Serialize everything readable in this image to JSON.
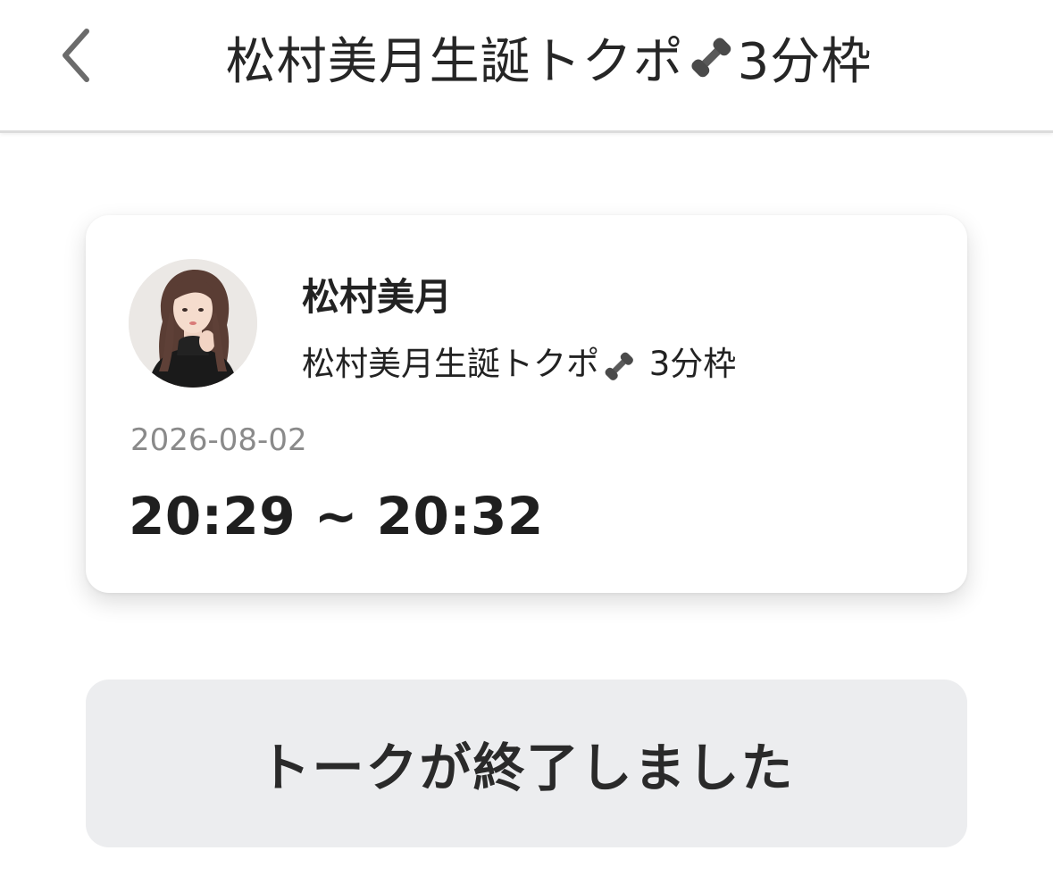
{
  "header": {
    "title_prefix": "松村美月生誕トクポ",
    "title_suffix": "3分枠",
    "back_icon": "chevron-left-icon"
  },
  "card": {
    "talent_name": "松村美月",
    "event_title_prefix": "松村美月生誕トクポ",
    "event_title_suffix": " 3分枠",
    "date": "2026-08-02",
    "time_range": "20:29 ~ 20:32"
  },
  "status": {
    "label": "トークが終了しました"
  },
  "colors": {
    "background": "#ffffff",
    "status_button_bg": "#ecedef",
    "date_text": "#8a8a8a",
    "phone_emoji": "#5a5a5a"
  }
}
